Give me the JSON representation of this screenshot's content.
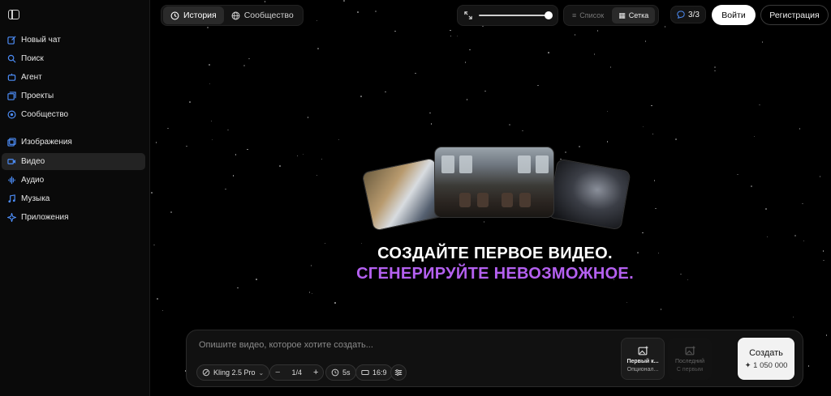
{
  "sidebar": {
    "items": [
      {
        "label": "Новый чат",
        "icon": "edit-icon"
      },
      {
        "label": "Поиск",
        "icon": "search-icon"
      },
      {
        "label": "Агент",
        "icon": "agent-icon"
      },
      {
        "label": "Проекты",
        "icon": "folder-icon"
      },
      {
        "label": "Сообщество",
        "icon": "community-icon"
      },
      {
        "label": "Изображения",
        "icon": "images-icon"
      },
      {
        "label": "Видео",
        "icon": "video-icon",
        "active": true
      },
      {
        "label": "Аудио",
        "icon": "audio-icon"
      },
      {
        "label": "Музыка",
        "icon": "music-icon"
      },
      {
        "label": "Приложения",
        "icon": "apps-icon"
      }
    ]
  },
  "topbar": {
    "tabs": [
      {
        "label": "История",
        "icon": "history-icon",
        "active": true
      },
      {
        "label": "Сообщество",
        "icon": "globe-icon",
        "active": false
      }
    ],
    "zoom_level": 1.0,
    "view": {
      "list_label": "Список",
      "grid_label": "Сетка",
      "selected": "grid"
    },
    "counter": "3/3",
    "login_label": "Войти",
    "register_label": "Регистрация"
  },
  "hero": {
    "title": "СОЗДАЙТЕ ПЕРВОЕ ВИДЕО.",
    "subtitle": "СГЕНЕРИРУЙТЕ НЕВОЗМОЖНОЕ."
  },
  "composer": {
    "placeholder": "Опишите видео, которое хотите создать...",
    "model": "Kling 2.5 Pro",
    "count": "1/4",
    "duration": "5s",
    "aspect": "16:9",
    "first_frame": {
      "title": "Первый к...",
      "sub": "Опционал..."
    },
    "last_frame": {
      "title": "Последний",
      "sub": "С первым"
    },
    "create_label": "Создать",
    "cost": "✦ 1 050 000"
  },
  "colors": {
    "accent_purple": "#b460f0",
    "sidebar_icon_blue": "#4c8cf5"
  }
}
